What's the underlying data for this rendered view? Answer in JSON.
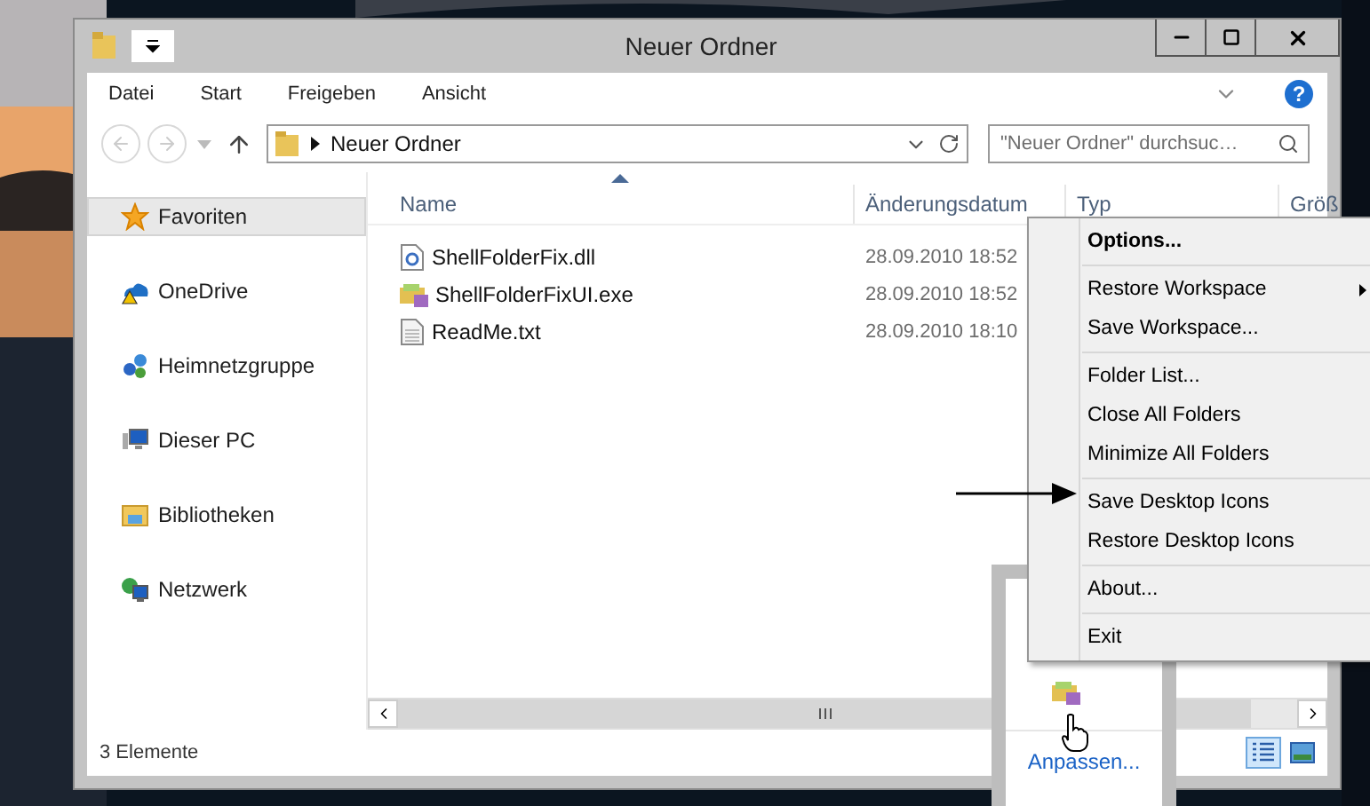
{
  "window": {
    "title": "Neuer Ordner"
  },
  "ribbon": {
    "tabs": [
      "Datei",
      "Start",
      "Freigeben",
      "Ansicht"
    ],
    "help": "?"
  },
  "address": {
    "path": "Neuer Ordner"
  },
  "search": {
    "placeholder": "\"Neuer Ordner\" durchsuc…"
  },
  "sidebar": {
    "items": [
      {
        "label": "Favoriten",
        "kind": "favorites",
        "selected": true
      },
      {
        "label": "OneDrive",
        "kind": "cloud",
        "selected": false
      },
      {
        "label": "Heimnetzgruppe",
        "kind": "homegroup",
        "selected": false
      },
      {
        "label": "Dieser PC",
        "kind": "pc",
        "selected": false
      },
      {
        "label": "Bibliotheken",
        "kind": "libraries",
        "selected": false
      },
      {
        "label": "Netzwerk",
        "kind": "network",
        "selected": false
      }
    ]
  },
  "table": {
    "columns": [
      "Name",
      "Änderungsdatum",
      "Typ",
      "Größ"
    ],
    "rows": [
      {
        "kind": "dll",
        "name": "ShellFolderFix.dll",
        "date": "28.09.2010 18:52"
      },
      {
        "kind": "exe",
        "name": "ShellFolderFixUI.exe",
        "date": "28.09.2010 18:52"
      },
      {
        "kind": "txt",
        "name": "ReadMe.txt",
        "date": "28.09.2010 18:10"
      }
    ]
  },
  "status_bar": {
    "count": "3 Elemente",
    "views": [
      {
        "kind": "details",
        "selected": true
      },
      {
        "kind": "thumbnails",
        "selected": false
      }
    ]
  },
  "context_menu": {
    "groups": [
      [
        {
          "label": "Options...",
          "bold": true,
          "submenu": false
        }
      ],
      [
        {
          "label": "Restore Workspace",
          "bold": false,
          "submenu": true
        },
        {
          "label": "Save Workspace...",
          "bold": false,
          "submenu": false
        }
      ],
      [
        {
          "label": "Folder List...",
          "bold": false,
          "submenu": false
        },
        {
          "label": "Close All Folders",
          "bold": false,
          "submenu": false
        },
        {
          "label": "Minimize All Folders",
          "bold": false,
          "submenu": false
        }
      ],
      [
        {
          "label": "Save Desktop Icons",
          "bold": false,
          "submenu": false
        },
        {
          "label": "Restore Desktop Icons",
          "bold": false,
          "submenu": false
        }
      ],
      [
        {
          "label": "About...",
          "bold": false,
          "submenu": false
        }
      ],
      [
        {
          "label": "Exit",
          "bold": false,
          "submenu": false
        }
      ]
    ]
  },
  "tray_popup": {
    "link": "Anpassen..."
  }
}
